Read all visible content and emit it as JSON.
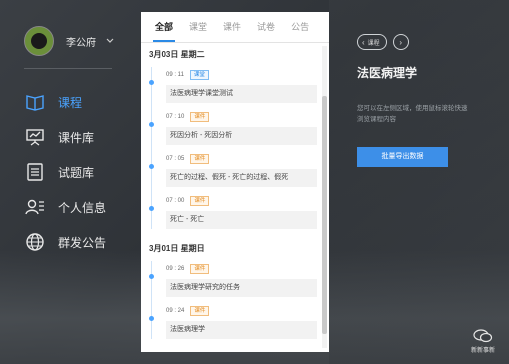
{
  "user": {
    "name": "李公府",
    "caret": "⌄"
  },
  "nav": [
    {
      "label": "课程",
      "icon": "book-icon",
      "active": true
    },
    {
      "label": "课件库",
      "icon": "presentation-icon",
      "active": false
    },
    {
      "label": "试题库",
      "icon": "document-list-icon",
      "active": false
    },
    {
      "label": "个人信息",
      "icon": "person-card-icon",
      "active": false
    },
    {
      "label": "群发公告",
      "icon": "globe-icon",
      "active": false
    }
  ],
  "tabs": [
    "全部",
    "课堂",
    "课件",
    "试卷",
    "公告"
  ],
  "timeline": [
    {
      "date": "3月03日  星期二",
      "entries": [
        {
          "time": "09 : 11",
          "badge": "课堂",
          "badge_color": "blue",
          "title": "法医病理学课堂测试"
        },
        {
          "time": "07 : 10",
          "badge": "课件",
          "badge_color": "orange",
          "title": "死因分析 - 死因分析"
        },
        {
          "time": "07 : 05",
          "badge": "课件",
          "badge_color": "orange",
          "title": "死亡的过程、假死 - 死亡的过程、假死"
        },
        {
          "time": "07 : 00",
          "badge": "课件",
          "badge_color": "orange",
          "title": "死亡 - 死亡"
        }
      ]
    },
    {
      "date": "3月01日  星期日",
      "entries": [
        {
          "time": "09 : 26",
          "badge": "课件",
          "badge_color": "orange",
          "title": "法医病理学研究的任务"
        },
        {
          "time": "09 : 24",
          "badge": "课件",
          "badge_color": "orange",
          "title": "法医病理学"
        }
      ]
    }
  ],
  "right": {
    "back_label": "课程",
    "course_title": "法医病理学",
    "hint": "您可以在左侧区域，使用鼠标滚轮快速浏览课程内容",
    "button_label": "批量导出数据"
  },
  "watermark": "新新事新",
  "colors": {
    "accent": "#3d8fe8",
    "active_nav": "#4aa3ff",
    "badge_blue": "#2b8ae6",
    "badge_orange": "#e38a1e"
  }
}
